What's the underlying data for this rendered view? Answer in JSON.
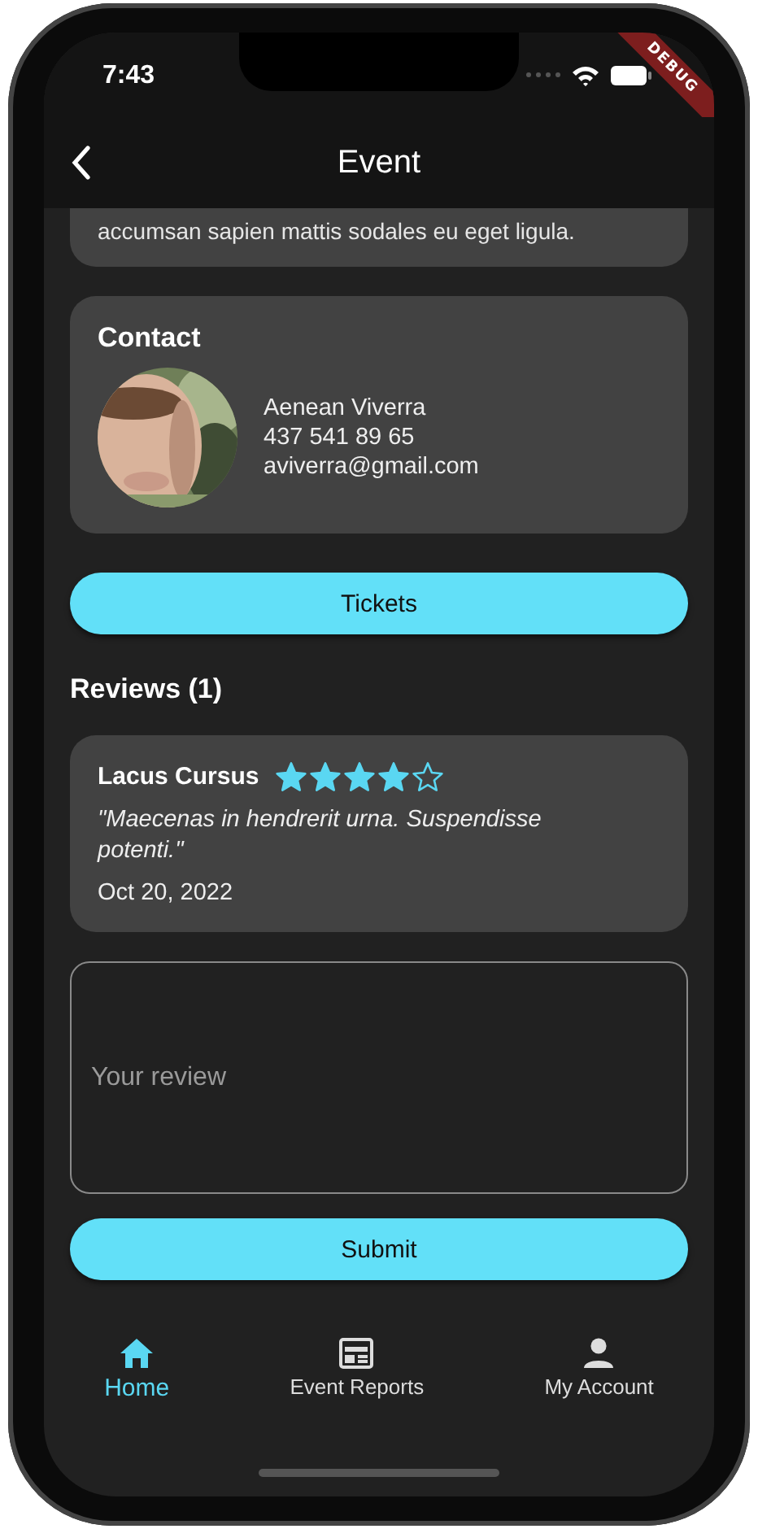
{
  "status_bar": {
    "time": "7:43"
  },
  "debug_banner": "DEBUG",
  "app_bar": {
    "title": "Event"
  },
  "description": {
    "text": "accumsan sapien mattis sodales eu eget ligula."
  },
  "contact": {
    "title": "Contact",
    "name": "Aenean Viverra",
    "phone": "437 541 89 65",
    "email": "aviverra@gmail.com"
  },
  "tickets_button": "Tickets",
  "reviews": {
    "title": "Reviews (1)",
    "items": [
      {
        "author": "Lacus Cursus",
        "stars": 4,
        "text": "\"Maecenas in hendrerit urna. Suspendisse potenti.\"",
        "date": "Oct 20, 2022"
      }
    ]
  },
  "review_field": {
    "placeholder": "Your review"
  },
  "submit_button": "Submit",
  "nav": [
    {
      "kind": "home",
      "label": "Home",
      "selected": true
    },
    {
      "kind": "reports",
      "label": "Event Reports",
      "selected": false
    },
    {
      "kind": "account",
      "label": "My Account",
      "selected": false
    }
  ]
}
